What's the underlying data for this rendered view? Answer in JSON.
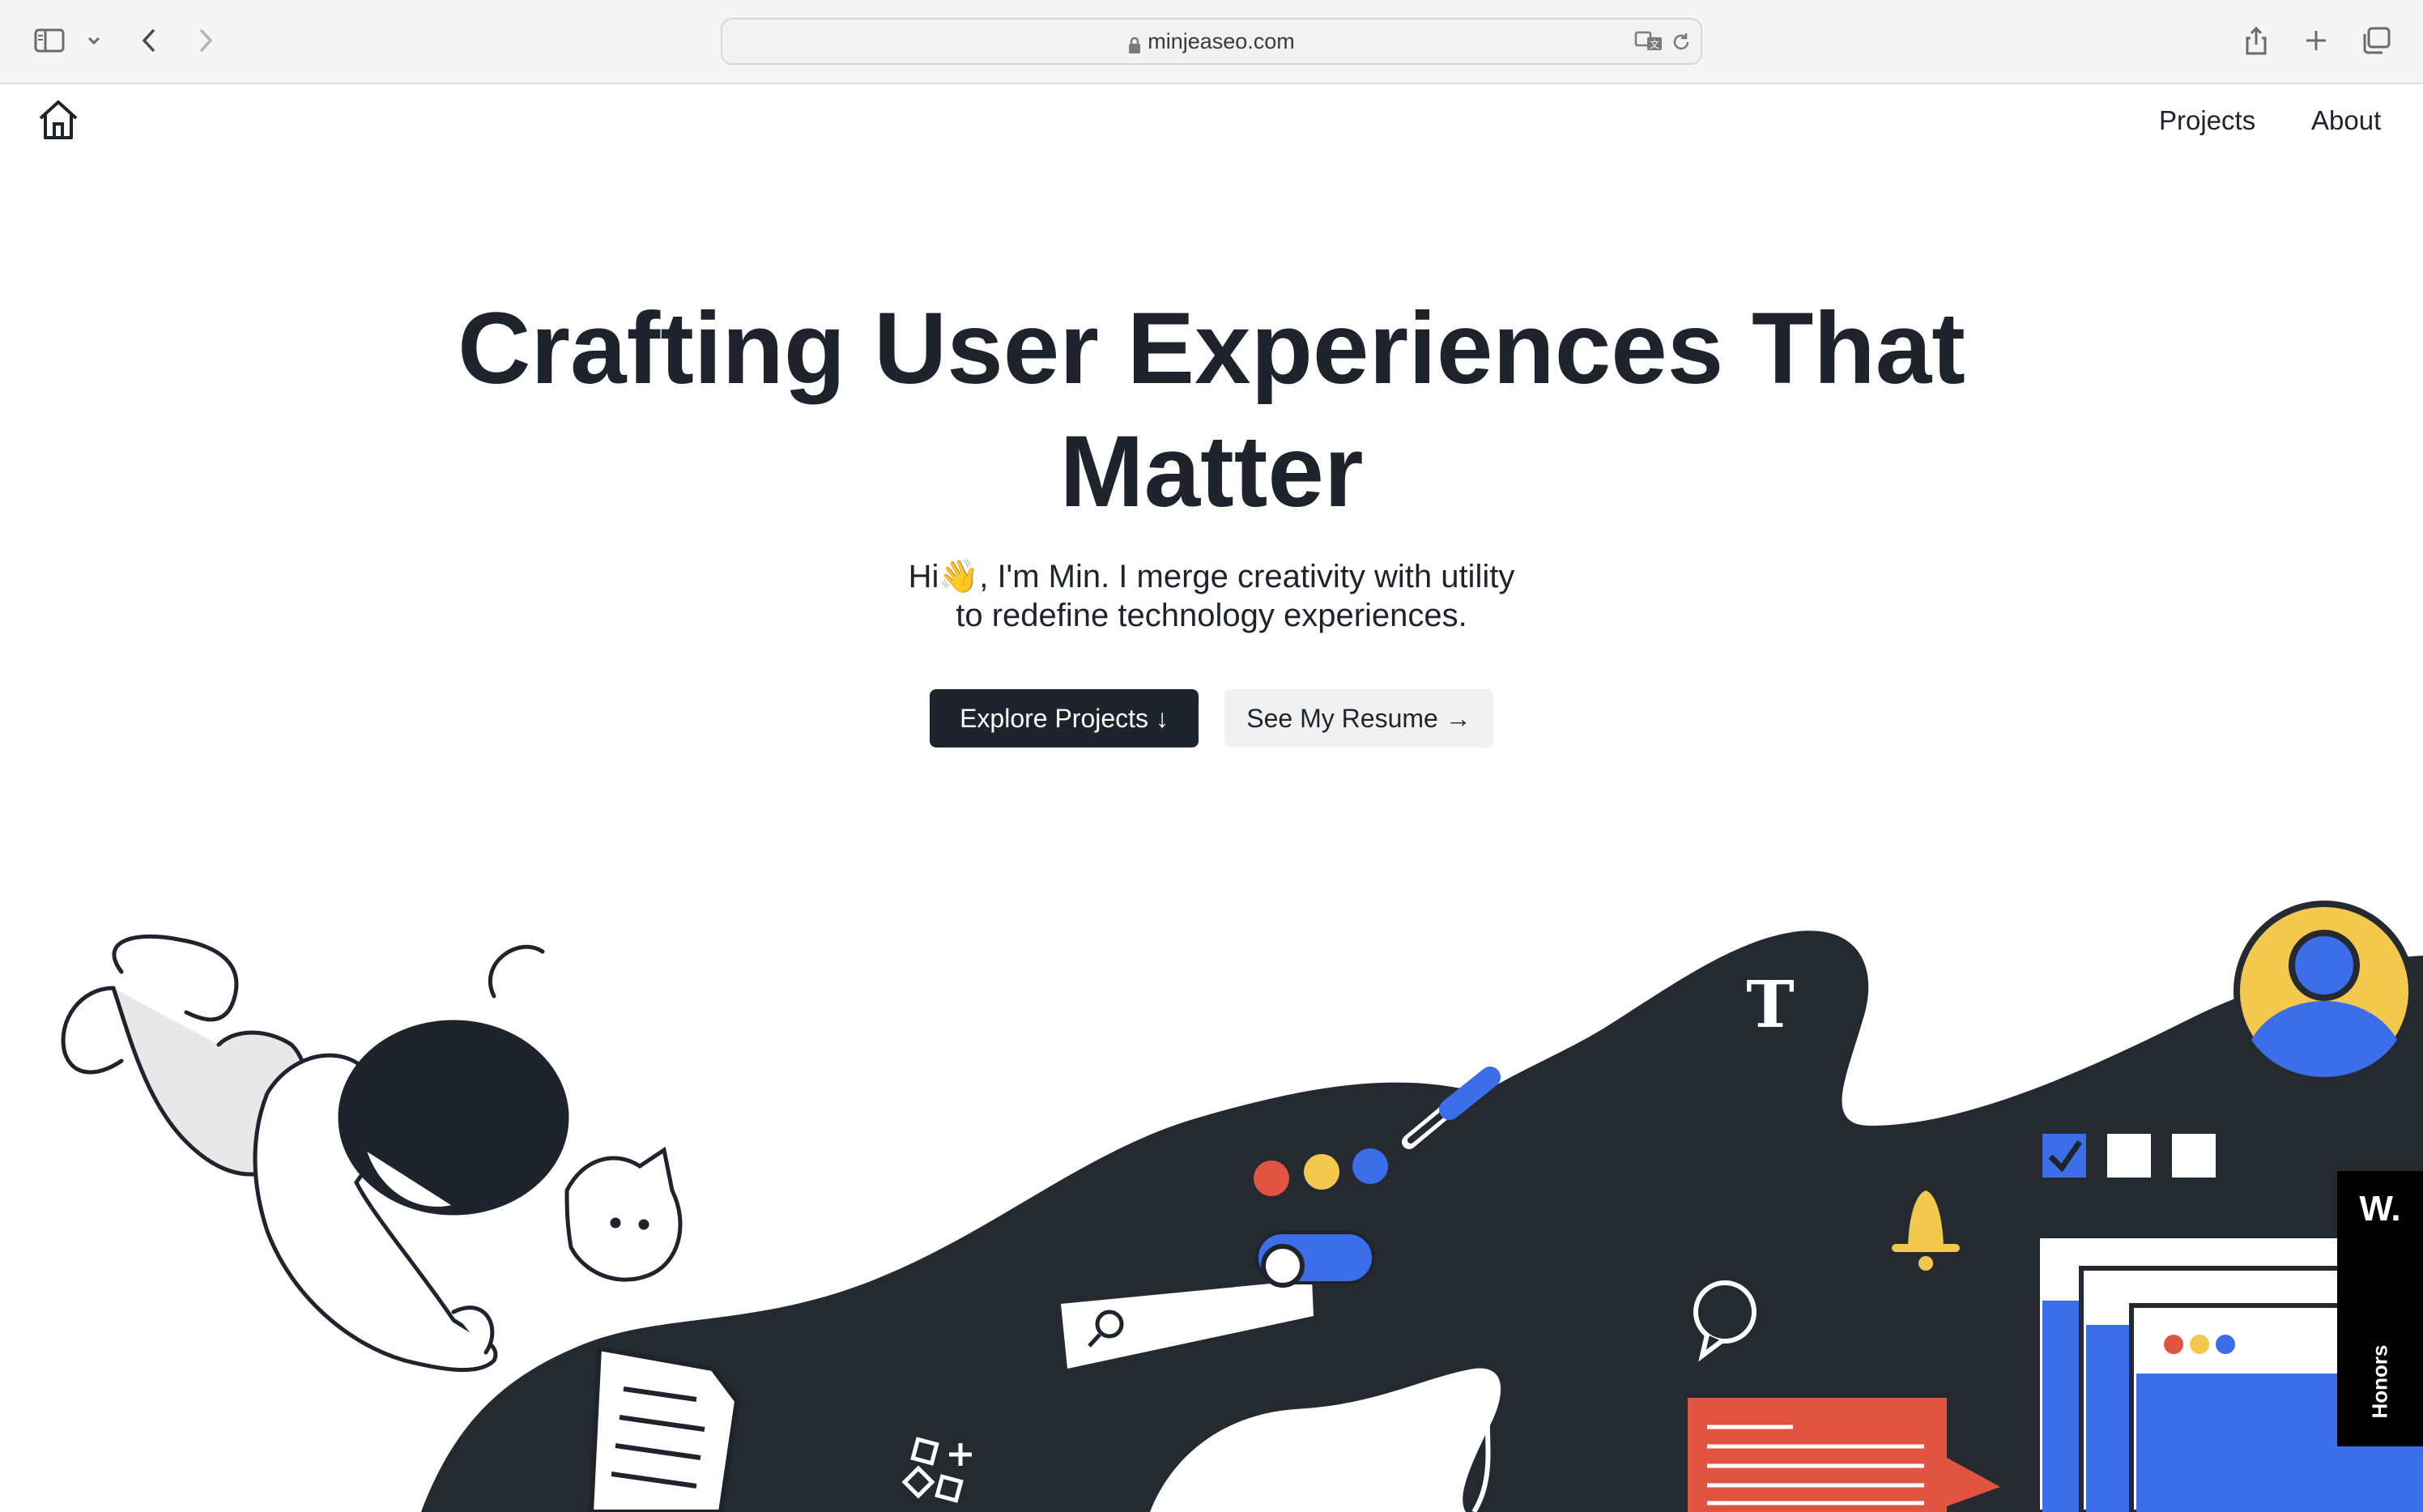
{
  "browser": {
    "url": "minjeaseo.com",
    "icons": [
      "sidebar-icon",
      "chevron-down-icon",
      "back-icon",
      "forward-icon",
      "lock-icon",
      "translate-icon",
      "reload-icon",
      "share-icon",
      "new-tab-icon",
      "tab-overview-icon"
    ]
  },
  "nav": {
    "home_icon": "home-icon",
    "links": [
      "Projects",
      "About"
    ]
  },
  "hero": {
    "title_line1": "Crafting User Experiences That",
    "title_line2": "Matter",
    "subtitle_line1": "Hi👋, I'm Min. I merge creativity with utility",
    "subtitle_line2": "to redefine technology experiences.",
    "primary_button": "Explore Projects ↓",
    "secondary_button": "See My Resume →"
  },
  "honors": {
    "logo": "W.",
    "label": "Honors"
  },
  "colors": {
    "dark": "#1f242c",
    "red": "#e05441",
    "yellow": "#f2c94c",
    "blue": "#3b6ee8"
  }
}
